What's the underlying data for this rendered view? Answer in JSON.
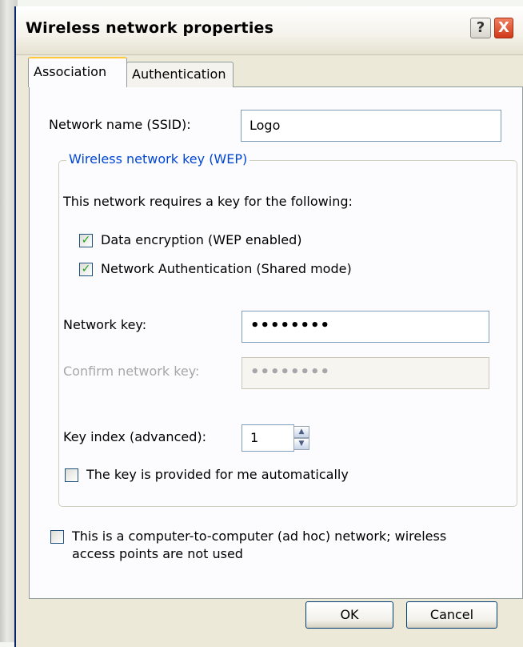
{
  "window": {
    "title": "Wireless network properties"
  },
  "title_buttons": {
    "help": "?",
    "close": "X"
  },
  "tabs": [
    {
      "label": "Association"
    },
    {
      "label": "Authentication"
    }
  ],
  "ssid": {
    "label": "Network name (SSID):",
    "value": "Logo"
  },
  "wep": {
    "legend": "Wireless network key (WEP)",
    "requires_text": "This network requires a key for the following:",
    "data_encryption": {
      "label": "Data encryption (WEP enabled)",
      "checked": true,
      "mark": "✓"
    },
    "network_auth": {
      "label": "Network Authentication (Shared mode)",
      "checked": true,
      "mark": "✓"
    },
    "network_key": {
      "label": "Network key:",
      "value": "••••••••"
    },
    "confirm_key": {
      "label": "Confirm network key:",
      "value": "••••••••"
    },
    "key_index": {
      "label": "Key index (advanced):",
      "value": "1",
      "up": "▲",
      "down": "▼"
    },
    "auto_key": {
      "label": "The key is provided for me automatically",
      "checked": false
    }
  },
  "adhoc": {
    "line1": "This is a computer-to-computer (ad hoc) network; wireless",
    "line2": "access points are not used",
    "checked": false
  },
  "buttons": {
    "ok": "OK",
    "cancel": "Cancel"
  },
  "colors": {
    "accent": "#0046d5",
    "tab_highlight": "#ffc83c",
    "check": "#21a121",
    "close": "#d03818"
  }
}
